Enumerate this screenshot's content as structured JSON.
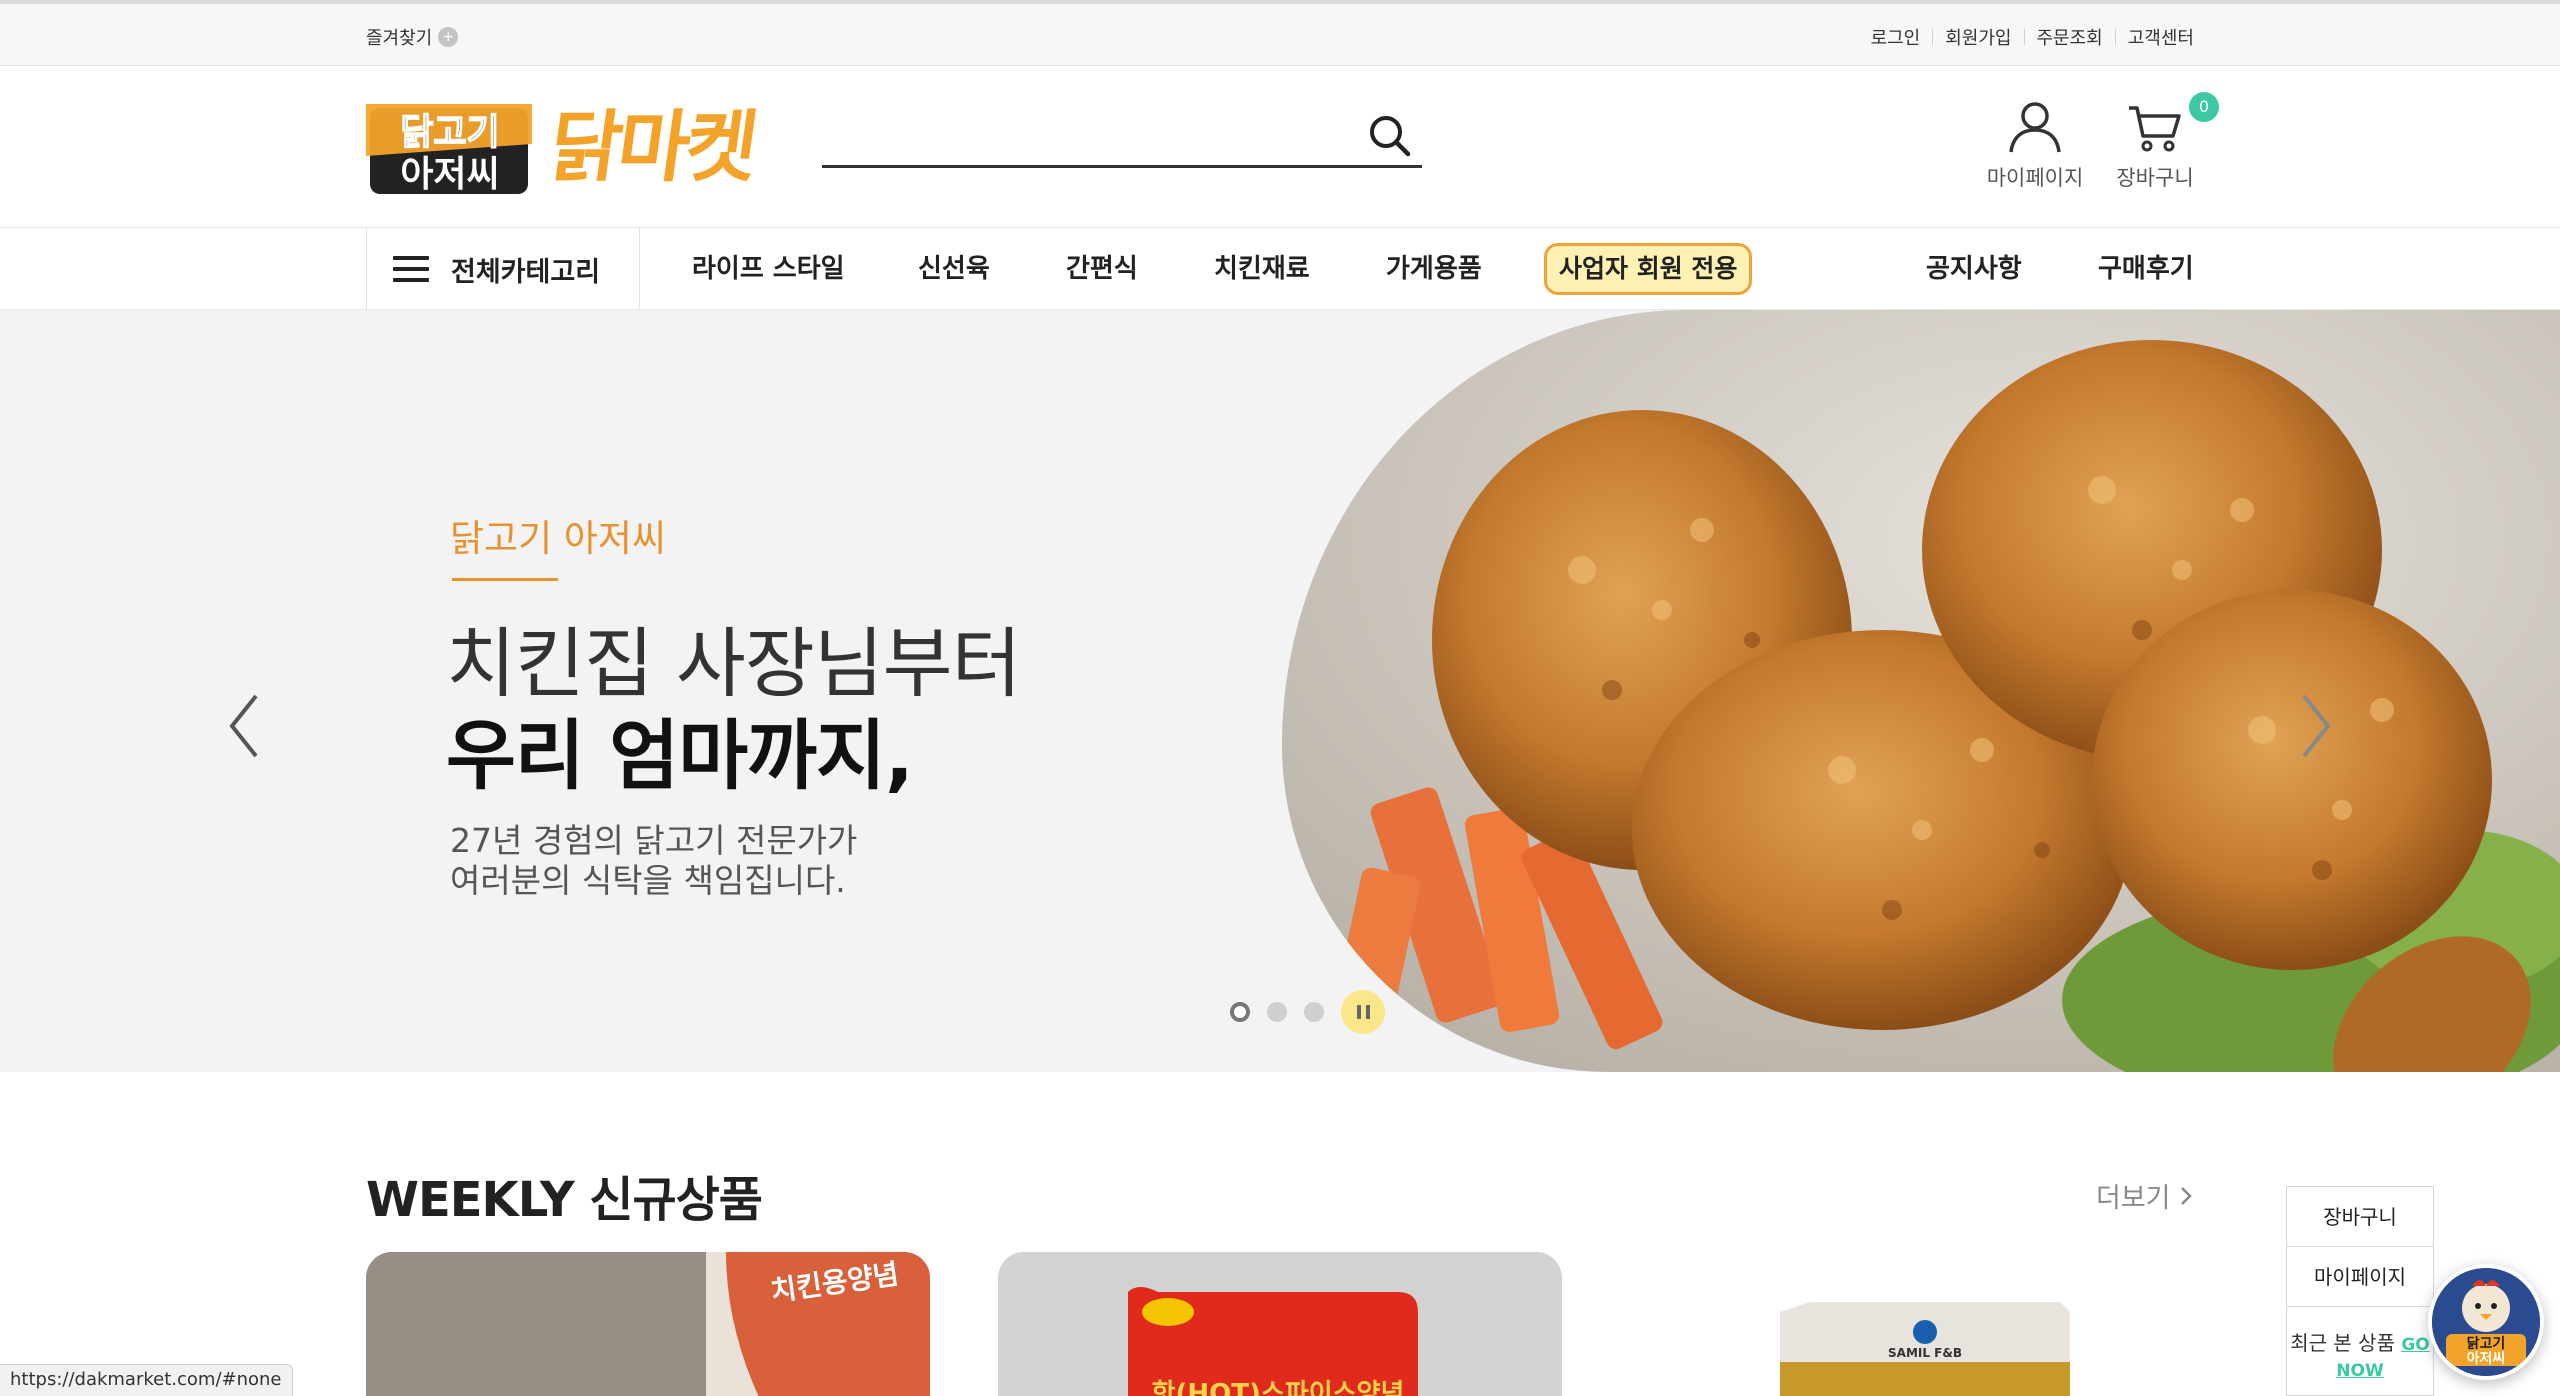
{
  "topbar": {
    "favorites_label": "즐겨찾기",
    "favorites_icon": "plus-icon",
    "links": [
      "로그인",
      "회원가입",
      "주문조회",
      "고객센터"
    ]
  },
  "header": {
    "logo_badge_line1": "닭고기",
    "logo_badge_line2": "아저씨",
    "logo_text": "닭마켓",
    "search_placeholder": "",
    "search_value": "",
    "search_icon": "search-icon",
    "mypage_label": "마이페이지",
    "cart_label": "장바구니",
    "cart_count": "0"
  },
  "nav": {
    "all_categories": "전체카테고리",
    "items": [
      "라이프 스타일",
      "신선육",
      "간편식",
      "치킨재료",
      "가게용품"
    ],
    "business_only": "사업자 회원 전용",
    "right_items": [
      "공지사항",
      "구매후기"
    ]
  },
  "hero": {
    "brand": "닭고기 아저씨",
    "headline_line1": "치킨집 사장님부터",
    "headline_line2": "우리 엄마까지,",
    "desc_line1": "27년 경험의 닭고기 전문가가",
    "desc_line2": "여러분의 식탁을 책임집니다.",
    "slide_count": 3,
    "active_slide": 1,
    "prev_icon": "chevron-left-icon",
    "next_icon": "chevron-right-icon",
    "pause_icon": "pause-icon"
  },
  "weekly": {
    "title": "WEEKLY 신규상품",
    "more_label": "더보기",
    "products": [
      {
        "image_text": "치킨용양념"
      },
      {
        "image_text": "핫(HOT)스파이스양념"
      },
      {
        "image_text": "SAMIL F&B"
      }
    ]
  },
  "quick_panel": {
    "cart": "장바구니",
    "mypage": "마이페이지",
    "recent": "최근 본 상품",
    "go_now_1": "GO",
    "go_now_2": "NOW"
  },
  "status_bar": {
    "url": "https://dakmarket.com/#none"
  },
  "colors": {
    "brand_orange": "#f4a32a",
    "accent_green": "#3cc8a4",
    "business_badge_bg": "#fdf2b4",
    "business_badge_border": "#f0a13a",
    "hero_bg": "#f3f3f3"
  }
}
